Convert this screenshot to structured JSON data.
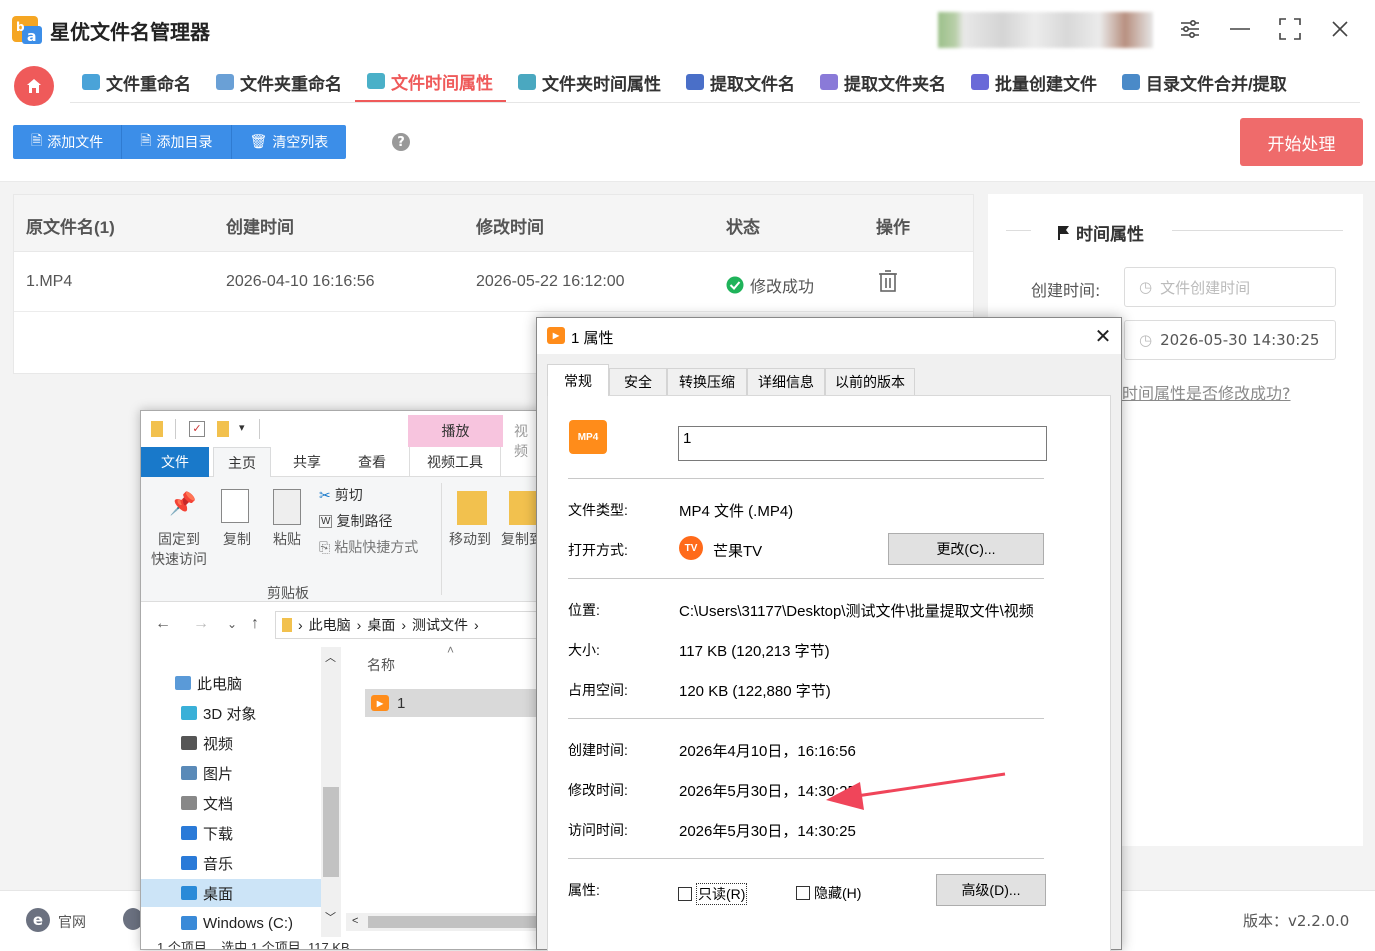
{
  "app": {
    "title": "星优文件名管理器",
    "accent": "#ef5a5a",
    "primary": "#3c8ee8"
  },
  "nav": {
    "tabs": [
      {
        "label": "文件重命名",
        "icon": "rename-icon",
        "color": "#4aa3d8"
      },
      {
        "label": "文件夹重命名",
        "icon": "folder-rename-icon",
        "color": "#6aa0d6"
      },
      {
        "label": "文件时间属性",
        "icon": "file-time-icon",
        "color": "#4ab0c8",
        "active": true
      },
      {
        "label": "文件夹时间属性",
        "icon": "folder-time-icon",
        "color": "#4aa8c0"
      },
      {
        "label": "提取文件名",
        "icon": "extract-file-icon",
        "color": "#4a6fc8"
      },
      {
        "label": "提取文件夹名",
        "icon": "extract-folder-icon",
        "color": "#8a7ad8"
      },
      {
        "label": "批量创建文件",
        "icon": "batch-create-icon",
        "color": "#6a6ad8"
      },
      {
        "label": "目录文件合并/提取",
        "icon": "merge-icon",
        "color": "#4a8ac8"
      }
    ]
  },
  "toolbar": {
    "add_file": "添加文件",
    "add_dir": "添加目录",
    "clear_list": "清空列表",
    "help": "?",
    "start": "开始处理"
  },
  "table": {
    "headers": [
      "原文件名(1)",
      "创建时间",
      "修改时间",
      "状态",
      "操作"
    ],
    "rows": [
      {
        "name": "1.MP4",
        "created": "2026-04-10 16:16:56",
        "modified": "2026-05-22 16:12:00",
        "status": "修改成功"
      }
    ]
  },
  "right_panel": {
    "title": "时间属性",
    "created_label": "创建时间:",
    "created_placeholder": "文件创建时间",
    "modified_value": "2026-05-30 14:30:25",
    "check_link": "时间属性是否修改成功?"
  },
  "footer": {
    "site_label": "官网",
    "version": "版本：v2.2.0.0"
  },
  "explorer": {
    "play_tab": "播放",
    "video_tools": "视频工具",
    "video_partial": "视频",
    "tabs": [
      "文件",
      "主页",
      "共享",
      "查看"
    ],
    "ribbon": {
      "pin": "固定到",
      "pin2": "快速访问",
      "copy": "复制",
      "paste": "粘贴",
      "cut": "剪切",
      "copy_path": "复制路径",
      "paste_shortcut": "粘贴快捷方式",
      "group": "剪贴板",
      "move_to": "移动到",
      "copy_to": "复制到"
    },
    "breadcrumb": [
      "此电脑",
      "桌面",
      "测试文件"
    ],
    "nav": [
      "此电脑",
      "3D 对象",
      "视频",
      "图片",
      "文档",
      "下载",
      "音乐",
      "桌面",
      "Windows (C:)"
    ],
    "column": "名称",
    "file": "1",
    "status": "1 个项目    选中 1 个项目  117 KB"
  },
  "props": {
    "title": "1 属性",
    "tabs": [
      "常规",
      "安全",
      "转换压缩",
      "详细信息",
      "以前的版本"
    ],
    "name": "1",
    "type_label": "文件类型:",
    "type_value": "MP4 文件 (.MP4)",
    "open_label": "打开方式:",
    "open_value": "芒果TV",
    "change_btn": "更改(C)...",
    "loc_label": "位置:",
    "loc_value": "C:\\Users\\31177\\Desktop\\测试文件\\批量提取文件\\视频",
    "size_label": "大小:",
    "size_value": "117 KB (120,213 字节)",
    "disk_label": "占用空间:",
    "disk_value": "120 KB (122,880 字节)",
    "created_label": "创建时间:",
    "created_value": "2026年4月10日，16:16:56",
    "modified_label": "修改时间:",
    "modified_value": "2026年5月30日，14:30:25",
    "accessed_label": "访问时间:",
    "accessed_value": "2026年5月30日，14:30:25",
    "attr_label": "属性:",
    "readonly": "只读(R)",
    "hidden": "隐藏(H)",
    "advanced": "高级(D)..."
  }
}
